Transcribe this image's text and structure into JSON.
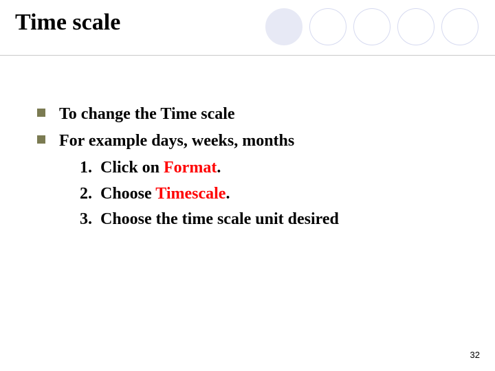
{
  "title": "Time scale",
  "bullets": [
    {
      "text": "To change the Time scale"
    },
    {
      "text": "For example days, weeks, months"
    }
  ],
  "steps": [
    {
      "num": "1.",
      "prefix": "Click on  ",
      "bold": "Format",
      "suffix": "."
    },
    {
      "num": "2.",
      "prefix": "Choose ",
      "bold": "Timescale",
      "suffix": "."
    },
    {
      "num": "3.",
      "prefix": "Choose the time scale unit desired",
      "bold": "",
      "suffix": ""
    }
  ],
  "pageNumber": "32"
}
